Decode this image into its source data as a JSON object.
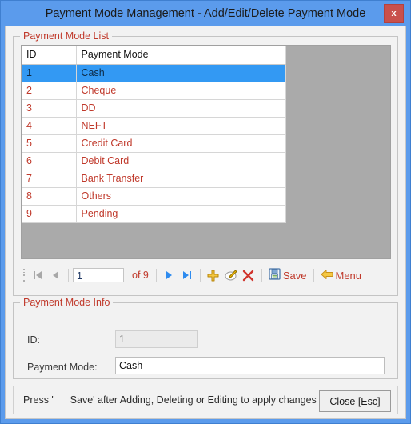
{
  "window": {
    "title": "Payment Mode Management - Add/Edit/Delete Payment Mode",
    "close_label": "x",
    "accent_blue": "#5b9bec",
    "close_red": "#c9504c"
  },
  "list_group": {
    "title": "Payment Mode List",
    "columns": [
      "ID",
      "Payment Mode"
    ],
    "rows": [
      {
        "id": "1",
        "mode": "Cash",
        "selected": true
      },
      {
        "id": "2",
        "mode": "Cheque",
        "selected": false
      },
      {
        "id": "3",
        "mode": "DD",
        "selected": false
      },
      {
        "id": "4",
        "mode": "NEFT",
        "selected": false
      },
      {
        "id": "5",
        "mode": "Credit Card",
        "selected": false
      },
      {
        "id": "6",
        "mode": "Debit Card",
        "selected": false
      },
      {
        "id": "7",
        "mode": "Bank Transfer",
        "selected": false
      },
      {
        "id": "8",
        "mode": "Others",
        "selected": false
      },
      {
        "id": "9",
        "mode": "Pending",
        "selected": false
      }
    ],
    "row_text_color": "#c0392b",
    "selected_bg": "#3399f3"
  },
  "navigator": {
    "first_label": "first-record",
    "prev_label": "previous-record",
    "position_value": "1",
    "of_label": "of 9",
    "next_label": "next-record",
    "last_label": "last-record",
    "add_label": "add-record",
    "edit_label": "edit-record",
    "delete_label": "delete-record",
    "save_label": "Save",
    "menu_label": "Menu"
  },
  "info_group": {
    "title": "Payment Mode Info",
    "id_label": "ID:",
    "id_value": "1",
    "mode_label": "Payment Mode:",
    "mode_value": "Cash"
  },
  "status": {
    "text": "Press '      Save' after Adding, Deleting or Editing to apply changes",
    "close_button": "Close [Esc]"
  }
}
